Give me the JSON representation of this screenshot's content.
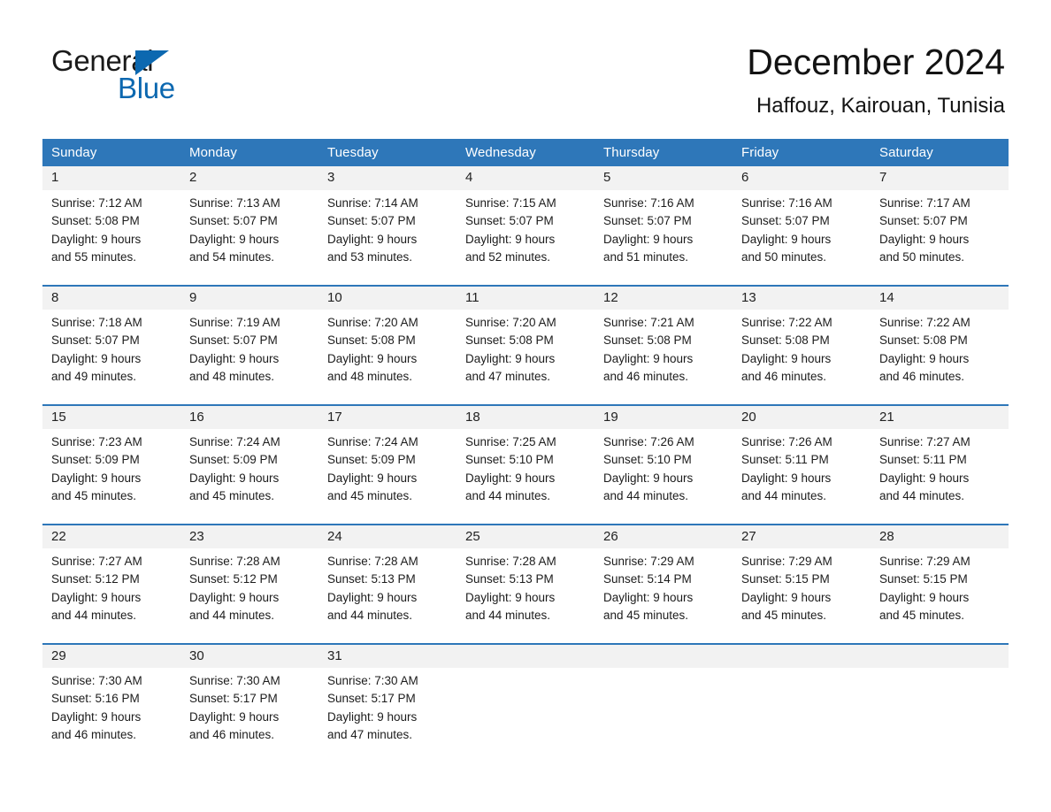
{
  "brand": {
    "name_part1": "General",
    "name_part2": "Blue",
    "accent_color": "#0c68b0"
  },
  "header": {
    "title": "December 2024",
    "location": "Haffouz, Kairouan, Tunisia",
    "header_bg_color": "#2e77b9",
    "row_band_color": "#f2f2f2"
  },
  "calendar": {
    "weekday_headers": [
      "Sunday",
      "Monday",
      "Tuesday",
      "Wednesday",
      "Thursday",
      "Friday",
      "Saturday"
    ],
    "weeks": [
      [
        {
          "day": "1",
          "sunrise": "Sunrise: 7:12 AM",
          "sunset": "Sunset: 5:08 PM",
          "daylight_1": "Daylight: 9 hours",
          "daylight_2": "and 55 minutes."
        },
        {
          "day": "2",
          "sunrise": "Sunrise: 7:13 AM",
          "sunset": "Sunset: 5:07 PM",
          "daylight_1": "Daylight: 9 hours",
          "daylight_2": "and 54 minutes."
        },
        {
          "day": "3",
          "sunrise": "Sunrise: 7:14 AM",
          "sunset": "Sunset: 5:07 PM",
          "daylight_1": "Daylight: 9 hours",
          "daylight_2": "and 53 minutes."
        },
        {
          "day": "4",
          "sunrise": "Sunrise: 7:15 AM",
          "sunset": "Sunset: 5:07 PM",
          "daylight_1": "Daylight: 9 hours",
          "daylight_2": "and 52 minutes."
        },
        {
          "day": "5",
          "sunrise": "Sunrise: 7:16 AM",
          "sunset": "Sunset: 5:07 PM",
          "daylight_1": "Daylight: 9 hours",
          "daylight_2": "and 51 minutes."
        },
        {
          "day": "6",
          "sunrise": "Sunrise: 7:16 AM",
          "sunset": "Sunset: 5:07 PM",
          "daylight_1": "Daylight: 9 hours",
          "daylight_2": "and 50 minutes."
        },
        {
          "day": "7",
          "sunrise": "Sunrise: 7:17 AM",
          "sunset": "Sunset: 5:07 PM",
          "daylight_1": "Daylight: 9 hours",
          "daylight_2": "and 50 minutes."
        }
      ],
      [
        {
          "day": "8",
          "sunrise": "Sunrise: 7:18 AM",
          "sunset": "Sunset: 5:07 PM",
          "daylight_1": "Daylight: 9 hours",
          "daylight_2": "and 49 minutes."
        },
        {
          "day": "9",
          "sunrise": "Sunrise: 7:19 AM",
          "sunset": "Sunset: 5:07 PM",
          "daylight_1": "Daylight: 9 hours",
          "daylight_2": "and 48 minutes."
        },
        {
          "day": "10",
          "sunrise": "Sunrise: 7:20 AM",
          "sunset": "Sunset: 5:08 PM",
          "daylight_1": "Daylight: 9 hours",
          "daylight_2": "and 48 minutes."
        },
        {
          "day": "11",
          "sunrise": "Sunrise: 7:20 AM",
          "sunset": "Sunset: 5:08 PM",
          "daylight_1": "Daylight: 9 hours",
          "daylight_2": "and 47 minutes."
        },
        {
          "day": "12",
          "sunrise": "Sunrise: 7:21 AM",
          "sunset": "Sunset: 5:08 PM",
          "daylight_1": "Daylight: 9 hours",
          "daylight_2": "and 46 minutes."
        },
        {
          "day": "13",
          "sunrise": "Sunrise: 7:22 AM",
          "sunset": "Sunset: 5:08 PM",
          "daylight_1": "Daylight: 9 hours",
          "daylight_2": "and 46 minutes."
        },
        {
          "day": "14",
          "sunrise": "Sunrise: 7:22 AM",
          "sunset": "Sunset: 5:08 PM",
          "daylight_1": "Daylight: 9 hours",
          "daylight_2": "and 46 minutes."
        }
      ],
      [
        {
          "day": "15",
          "sunrise": "Sunrise: 7:23 AM",
          "sunset": "Sunset: 5:09 PM",
          "daylight_1": "Daylight: 9 hours",
          "daylight_2": "and 45 minutes."
        },
        {
          "day": "16",
          "sunrise": "Sunrise: 7:24 AM",
          "sunset": "Sunset: 5:09 PM",
          "daylight_1": "Daylight: 9 hours",
          "daylight_2": "and 45 minutes."
        },
        {
          "day": "17",
          "sunrise": "Sunrise: 7:24 AM",
          "sunset": "Sunset: 5:09 PM",
          "daylight_1": "Daylight: 9 hours",
          "daylight_2": "and 45 minutes."
        },
        {
          "day": "18",
          "sunrise": "Sunrise: 7:25 AM",
          "sunset": "Sunset: 5:10 PM",
          "daylight_1": "Daylight: 9 hours",
          "daylight_2": "and 44 minutes."
        },
        {
          "day": "19",
          "sunrise": "Sunrise: 7:26 AM",
          "sunset": "Sunset: 5:10 PM",
          "daylight_1": "Daylight: 9 hours",
          "daylight_2": "and 44 minutes."
        },
        {
          "day": "20",
          "sunrise": "Sunrise: 7:26 AM",
          "sunset": "Sunset: 5:11 PM",
          "daylight_1": "Daylight: 9 hours",
          "daylight_2": "and 44 minutes."
        },
        {
          "day": "21",
          "sunrise": "Sunrise: 7:27 AM",
          "sunset": "Sunset: 5:11 PM",
          "daylight_1": "Daylight: 9 hours",
          "daylight_2": "and 44 minutes."
        }
      ],
      [
        {
          "day": "22",
          "sunrise": "Sunrise: 7:27 AM",
          "sunset": "Sunset: 5:12 PM",
          "daylight_1": "Daylight: 9 hours",
          "daylight_2": "and 44 minutes."
        },
        {
          "day": "23",
          "sunrise": "Sunrise: 7:28 AM",
          "sunset": "Sunset: 5:12 PM",
          "daylight_1": "Daylight: 9 hours",
          "daylight_2": "and 44 minutes."
        },
        {
          "day": "24",
          "sunrise": "Sunrise: 7:28 AM",
          "sunset": "Sunset: 5:13 PM",
          "daylight_1": "Daylight: 9 hours",
          "daylight_2": "and 44 minutes."
        },
        {
          "day": "25",
          "sunrise": "Sunrise: 7:28 AM",
          "sunset": "Sunset: 5:13 PM",
          "daylight_1": "Daylight: 9 hours",
          "daylight_2": "and 44 minutes."
        },
        {
          "day": "26",
          "sunrise": "Sunrise: 7:29 AM",
          "sunset": "Sunset: 5:14 PM",
          "daylight_1": "Daylight: 9 hours",
          "daylight_2": "and 45 minutes."
        },
        {
          "day": "27",
          "sunrise": "Sunrise: 7:29 AM",
          "sunset": "Sunset: 5:15 PM",
          "daylight_1": "Daylight: 9 hours",
          "daylight_2": "and 45 minutes."
        },
        {
          "day": "28",
          "sunrise": "Sunrise: 7:29 AM",
          "sunset": "Sunset: 5:15 PM",
          "daylight_1": "Daylight: 9 hours",
          "daylight_2": "and 45 minutes."
        }
      ],
      [
        {
          "day": "29",
          "sunrise": "Sunrise: 7:30 AM",
          "sunset": "Sunset: 5:16 PM",
          "daylight_1": "Daylight: 9 hours",
          "daylight_2": "and 46 minutes."
        },
        {
          "day": "30",
          "sunrise": "Sunrise: 7:30 AM",
          "sunset": "Sunset: 5:17 PM",
          "daylight_1": "Daylight: 9 hours",
          "daylight_2": "and 46 minutes."
        },
        {
          "day": "31",
          "sunrise": "Sunrise: 7:30 AM",
          "sunset": "Sunset: 5:17 PM",
          "daylight_1": "Daylight: 9 hours",
          "daylight_2": "and 47 minutes."
        },
        {
          "day": "",
          "sunrise": "",
          "sunset": "",
          "daylight_1": "",
          "daylight_2": ""
        },
        {
          "day": "",
          "sunrise": "",
          "sunset": "",
          "daylight_1": "",
          "daylight_2": ""
        },
        {
          "day": "",
          "sunrise": "",
          "sunset": "",
          "daylight_1": "",
          "daylight_2": ""
        },
        {
          "day": "",
          "sunrise": "",
          "sunset": "",
          "daylight_1": "",
          "daylight_2": ""
        }
      ]
    ]
  }
}
